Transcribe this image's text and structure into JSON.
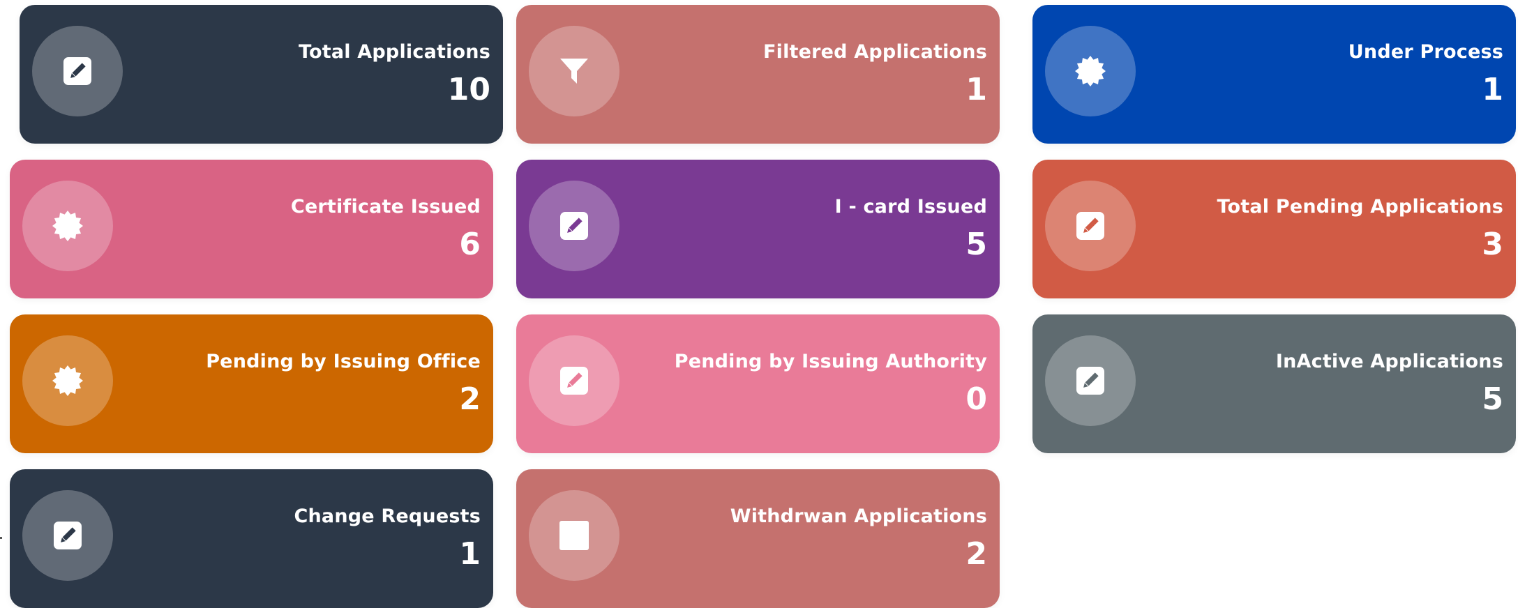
{
  "cards": [
    {
      "label": "Total Applications",
      "count": "10",
      "color": "#2c3848",
      "icon": "edit-icon"
    },
    {
      "label": "Filtered Applications",
      "count": "1",
      "color": "#c5716e",
      "icon": "filter-icon"
    },
    {
      "label": "Under Process",
      "count": "1",
      "color": "#0046b0",
      "icon": "badge-icon"
    },
    {
      "label": "Certificate Issued",
      "count": "6",
      "color": "#d96384",
      "icon": "badge-icon"
    },
    {
      "label": "I - card Issued",
      "count": "5",
      "color": "#7a3a93",
      "icon": "edit-icon"
    },
    {
      "label": "Total Pending Applications",
      "count": "3",
      "color": "#d15b45",
      "icon": "edit-icon"
    },
    {
      "label": "Pending by Issuing Office",
      "count": "2",
      "color": "#cc6700",
      "icon": "badge-icon"
    },
    {
      "label": "Pending by Issuing Authority",
      "count": "0",
      "color": "#e97b98",
      "icon": "edit-icon"
    },
    {
      "label": "InActive Applications",
      "count": "5",
      "color": "#5f6b70",
      "icon": "edit-icon"
    },
    {
      "label": "Change Requests",
      "count": "1",
      "color": "#2c3848",
      "icon": "edit-icon"
    },
    {
      "label": "Withdrwan Applications",
      "count": "2",
      "color": "#c5716e",
      "icon": "square-icon"
    }
  ]
}
